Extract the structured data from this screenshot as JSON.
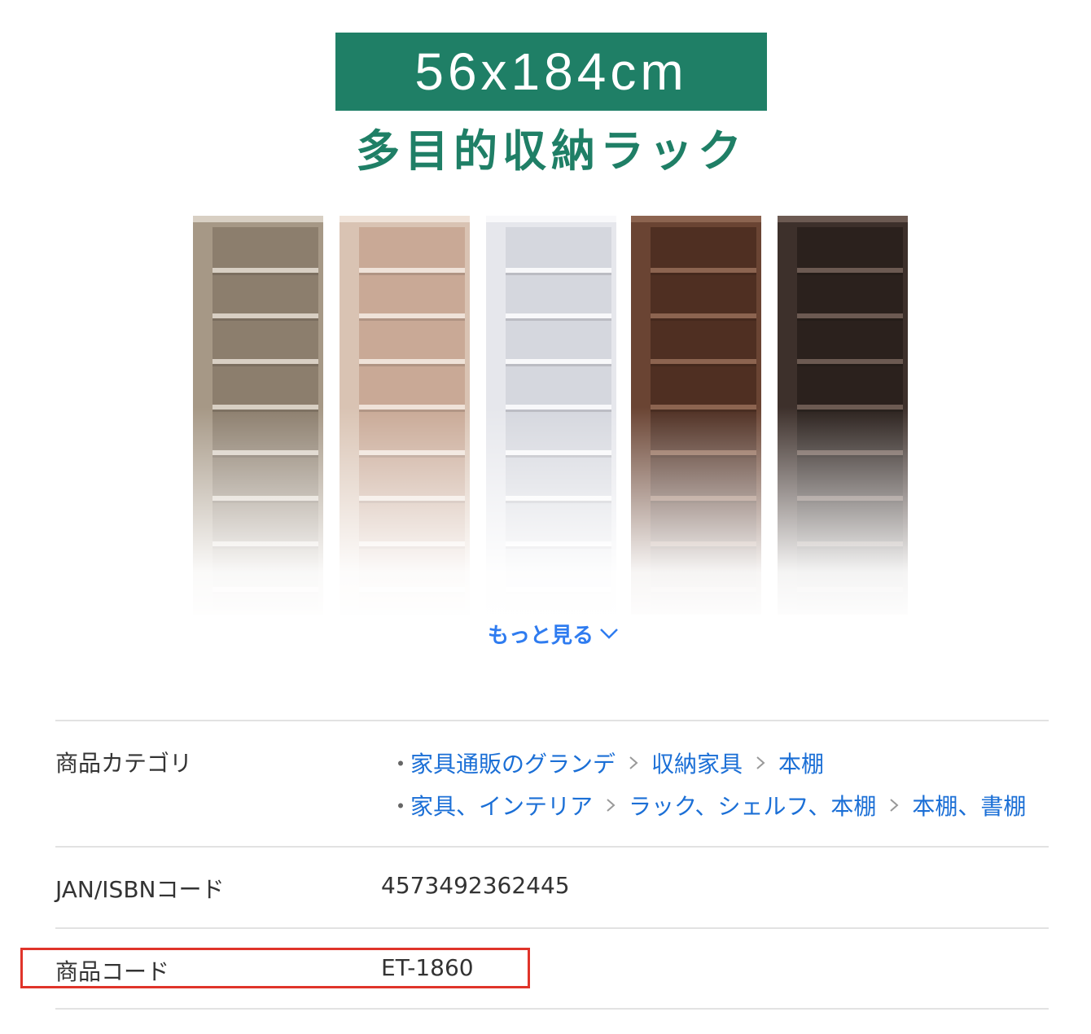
{
  "banner": {
    "size_text": "56x184cm",
    "product_name": "多目的収納ラック"
  },
  "shelf_colors": [
    {
      "name": "natural",
      "side": "#a69886",
      "back": "#8c7e6d",
      "board": "#d8cfc3"
    },
    {
      "name": "white-oak",
      "side": "#d9c3b3",
      "back": "#c9a996",
      "board": "#efe2d8"
    },
    {
      "name": "white",
      "side": "#e6e7ec",
      "back": "#d5d7de",
      "board": "#f8f8fa"
    },
    {
      "name": "brown",
      "side": "#6a4433",
      "back": "#4f2f22",
      "board": "#8c6450"
    },
    {
      "name": "dark-brown",
      "side": "#3d302b",
      "back": "#2b211d",
      "board": "#6c5a52"
    }
  ],
  "more": {
    "label": "もっと見る"
  },
  "details": {
    "category": {
      "label": "商品カテゴリ",
      "paths": [
        [
          "家具通販のグランデ",
          "収納家具",
          "本棚"
        ],
        [
          "家具、インテリア",
          "ラック、シェルフ、本棚",
          "本棚、書棚"
        ]
      ]
    },
    "jan": {
      "label": "JAN/ISBNコード",
      "value": "4573492362445"
    },
    "code": {
      "label": "商品コード",
      "value": "ET-1860"
    }
  }
}
